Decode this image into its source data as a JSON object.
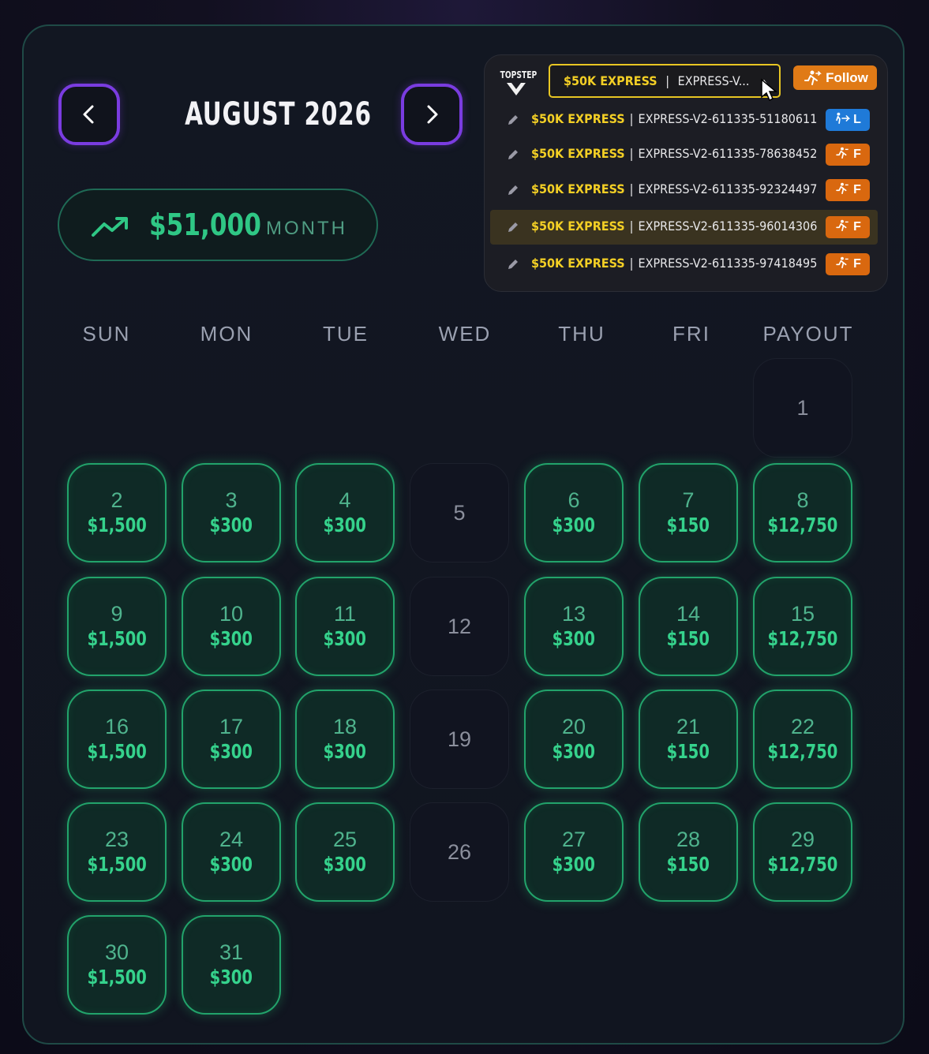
{
  "header": {
    "month_title": "AUGUST 2026",
    "prev_icon": "chevron-left-icon",
    "next_icon": "chevron-right-icon"
  },
  "summary": {
    "icon": "trending-up-icon",
    "amount": "$51,000",
    "period": "MONTH"
  },
  "weekdays": [
    "SUN",
    "MON",
    "TUE",
    "WED",
    "THU",
    "FRI",
    "PAYOUT"
  ],
  "days": [
    {
      "n": "1",
      "amt": ""
    },
    {
      "n": "2",
      "amt": "$1,500"
    },
    {
      "n": "3",
      "amt": "$300"
    },
    {
      "n": "4",
      "amt": "$300"
    },
    {
      "n": "5",
      "amt": ""
    },
    {
      "n": "6",
      "amt": "$300"
    },
    {
      "n": "7",
      "amt": "$150"
    },
    {
      "n": "8",
      "amt": "$12,750"
    },
    {
      "n": "9",
      "amt": "$1,500"
    },
    {
      "n": "10",
      "amt": "$300"
    },
    {
      "n": "11",
      "amt": "$300"
    },
    {
      "n": "12",
      "amt": ""
    },
    {
      "n": "13",
      "amt": "$300"
    },
    {
      "n": "14",
      "amt": "$150"
    },
    {
      "n": "15",
      "amt": "$12,750"
    },
    {
      "n": "16",
      "amt": "$1,500"
    },
    {
      "n": "17",
      "amt": "$300"
    },
    {
      "n": "18",
      "amt": "$300"
    },
    {
      "n": "19",
      "amt": ""
    },
    {
      "n": "20",
      "amt": "$300"
    },
    {
      "n": "21",
      "amt": "$150"
    },
    {
      "n": "22",
      "amt": "$12,750"
    },
    {
      "n": "23",
      "amt": "$1,500"
    },
    {
      "n": "24",
      "amt": "$300"
    },
    {
      "n": "25",
      "amt": "$300"
    },
    {
      "n": "26",
      "amt": ""
    },
    {
      "n": "27",
      "amt": "$300"
    },
    {
      "n": "28",
      "amt": "$150"
    },
    {
      "n": "29",
      "amt": "$12,750"
    },
    {
      "n": "30",
      "amt": "$1,500"
    },
    {
      "n": "31",
      "amt": "$300"
    }
  ],
  "account_selector": {
    "brand": "TOPSTEP",
    "selected_plan": "$50K EXPRESS",
    "selected_separator": "|",
    "selected_account": "EXPRESS-V...",
    "follow_label": "Follow",
    "options": [
      {
        "plan": "$50K EXPRESS",
        "sep": "|",
        "account": "EXPRESS-V2-611335-51180611",
        "tag": "L",
        "highlighted": false
      },
      {
        "plan": "$50K EXPRESS",
        "sep": "|",
        "account": "EXPRESS-V2-611335-78638452",
        "tag": "F",
        "highlighted": false
      },
      {
        "plan": "$50K EXPRESS",
        "sep": "|",
        "account": "EXPRESS-V2-611335-92324497",
        "tag": "F",
        "highlighted": false
      },
      {
        "plan": "$50K EXPRESS",
        "sep": "|",
        "account": "EXPRESS-V2-611335-96014306",
        "tag": "F",
        "highlighted": true
      },
      {
        "plan": "$50K EXPRESS",
        "sep": "|",
        "account": "EXPRESS-V2-611335-97418495",
        "tag": "F",
        "highlighted": false
      }
    ]
  },
  "colors": {
    "accent_green": "#35d28c",
    "nav_purple": "#7a3ce0",
    "select_yellow": "#f3cf25",
    "follow_orange": "#e07a16",
    "leader_blue": "#1f7ad8"
  }
}
